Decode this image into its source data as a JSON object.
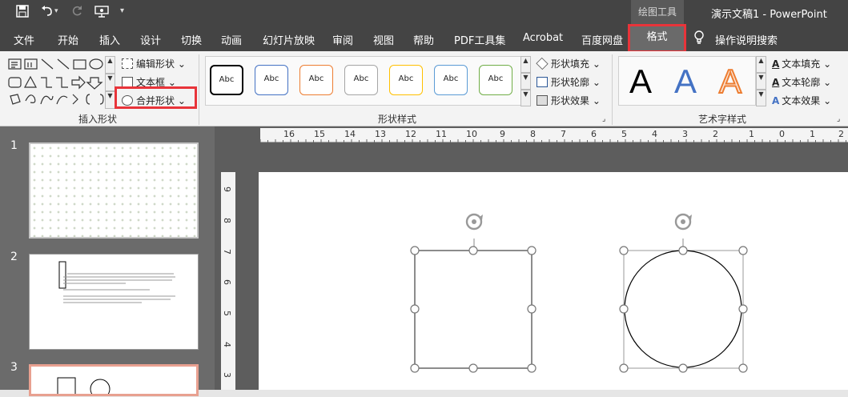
{
  "titlebar": {
    "context_group": "绘图工具",
    "document_title": "演示文稿1 - PowerPoint",
    "quick_access": [
      "save",
      "undo",
      "redo",
      "present",
      "customize"
    ]
  },
  "tabs": [
    "文件",
    "开始",
    "插入",
    "设计",
    "切换",
    "动画",
    "幻灯片放映",
    "审阅",
    "视图",
    "帮助",
    "PDF工具集",
    "Acrobat",
    "百度网盘",
    "格式"
  ],
  "tell_me": "操作说明搜索",
  "ribbon": {
    "insert_shapes": {
      "label": "插入形状",
      "edit_shape": "编辑形状",
      "text_box": "文本框",
      "merge_shapes": "合并形状"
    },
    "shape_styles": {
      "label": "形状样式",
      "preset_label": "Abc",
      "presets": [
        {
          "border": "#000000"
        },
        {
          "border": "#4472c4"
        },
        {
          "border": "#ed7d31"
        },
        {
          "border": "#a5a5a5"
        },
        {
          "border": "#ffc000"
        },
        {
          "border": "#5b9bd5"
        },
        {
          "border": "#70ad47"
        }
      ],
      "fill": "形状填充",
      "outline": "形状轮廓",
      "effects": "形状效果"
    },
    "wordart_styles": {
      "label": "艺术字样式",
      "letter": "A",
      "text_fill": "文本填充",
      "text_outline": "文本轮廓",
      "text_effects": "文本效果"
    }
  },
  "slides": [
    "1",
    "2",
    "3"
  ],
  "ruler": {
    "horizontal": [
      "16",
      "15",
      "14",
      "13",
      "12",
      "11",
      "10",
      "9",
      "8",
      "7",
      "6",
      "5",
      "4",
      "3",
      "2",
      "1",
      "0",
      "1",
      "2"
    ],
    "vertical": [
      "9",
      "8",
      "7",
      "6",
      "5",
      "4",
      "3"
    ]
  },
  "colors": {
    "highlight": "#e8343a",
    "titlebar": "#444444",
    "ribbon": "#f3f3f3",
    "workspace": "#5d5d5d"
  }
}
